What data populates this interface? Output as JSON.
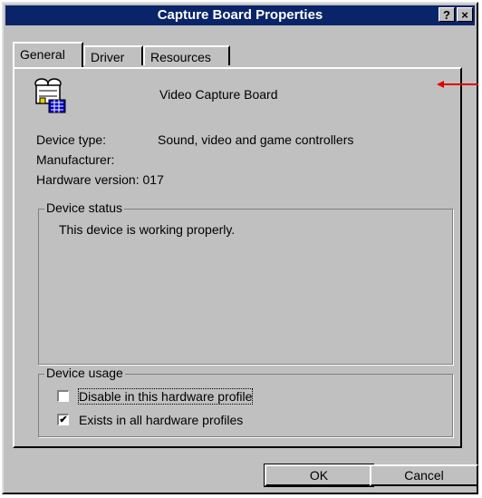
{
  "window": {
    "title": "Capture Board Properties",
    "help_button": "?",
    "close_button": "×"
  },
  "tabs": [
    {
      "label": "General",
      "active": true
    },
    {
      "label": "Driver",
      "active": false
    },
    {
      "label": "Resources",
      "active": false
    }
  ],
  "device": {
    "icon": "video-capture-device-icon",
    "name": "Video Capture Board",
    "type_label": "Device type:",
    "type_value": "Sound, video and game controllers",
    "manufacturer_label": "Manufacturer:",
    "hardware_version_label": "Hardware version:",
    "hardware_version_value": "017"
  },
  "device_status": {
    "title": "Device status",
    "text": "This device is working properly."
  },
  "device_usage": {
    "title": "Device usage",
    "options": [
      {
        "label": "Disable in this hardware profile",
        "checked": false,
        "focused": true
      },
      {
        "label": "Exists in all hardware profiles",
        "checked": true,
        "focused": false
      }
    ]
  },
  "buttons": {
    "ok": "OK",
    "cancel": "Cancel"
  },
  "colors": {
    "titlebar": "#0a246a",
    "annotation_arrow": "#e00000"
  }
}
